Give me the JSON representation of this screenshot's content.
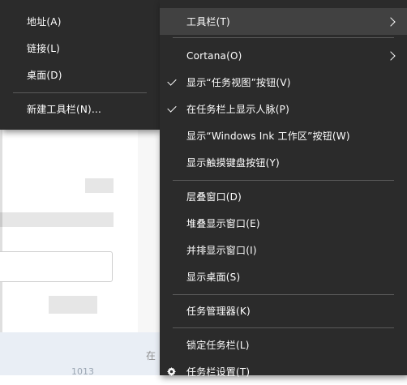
{
  "submenu": {
    "items": [
      {
        "label": "地址(A)"
      },
      {
        "label": "链接(L)"
      },
      {
        "label": "桌面(D)"
      },
      {
        "label": "新建工具栏(N)..."
      }
    ]
  },
  "context_menu": {
    "toolbars": "工具栏(T)",
    "cortana": "Cortana(O)",
    "show_task_view_button": "显示“任务视图”按钮(V)",
    "show_people": "在任务栏上显示人脉(P)",
    "show_ink_workspace": "显示“Windows Ink 工作区”按钮(W)",
    "show_touch_keyboard": "显示触摸键盘按钮(Y)",
    "cascade": "层叠窗口(D)",
    "stacked": "堆叠显示窗口(E)",
    "side_by_side": "并排显示窗口(I)",
    "show_desktop": "显示桌面(S)",
    "task_manager": "任务管理器(K)",
    "lock_taskbar": "锁定任务栏(L)",
    "taskbar_settings": "任务栏设置(T)"
  },
  "background": {
    "side_text": "在",
    "bottom_text": "1013"
  },
  "colors": {
    "menu_bg": "#2b2b2b",
    "menu_hover": "#414141",
    "separator": "#5a5a5a",
    "text": "#ffffff"
  }
}
